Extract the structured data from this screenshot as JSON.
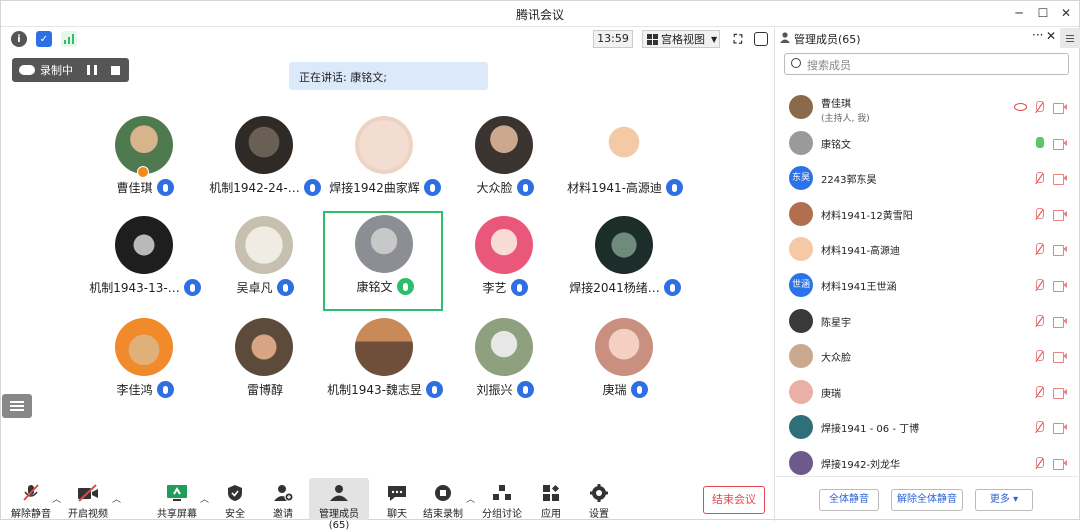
{
  "app": {
    "title": "腾讯会议"
  },
  "topbar": {
    "time": "13:59",
    "view_label": "宫格视图"
  },
  "recording": {
    "label": "录制中"
  },
  "speaking": {
    "text": "正在讲话: 康铭文;"
  },
  "participants": [
    {
      "name": "曹佳琪",
      "mic": "on",
      "host": true
    },
    {
      "name": "机制1942-24-…",
      "mic": "on"
    },
    {
      "name": "焊接1942曲家辉",
      "mic": "on"
    },
    {
      "name": "大众脸",
      "mic": "on"
    },
    {
      "name": "材料1941-高源迪",
      "mic": "on"
    },
    {
      "name": "机制1943-13-…",
      "mic": "on"
    },
    {
      "name": "吴卓凡",
      "mic": "on"
    },
    {
      "name": "康铭文",
      "mic": "speaking",
      "active": true
    },
    {
      "name": "李艺",
      "mic": "on"
    },
    {
      "name": "焊接2041杨绪…",
      "mic": "on"
    },
    {
      "name": "李佳鸿",
      "mic": "on"
    },
    {
      "name": "雷博醇",
      "mic": "none"
    },
    {
      "name": "机制1943-魏志昱",
      "mic": "on"
    },
    {
      "name": "刘振兴",
      "mic": "on"
    },
    {
      "name": "庚瑞",
      "mic": "on"
    }
  ],
  "toolbar": {
    "unmute": "解除静音",
    "start_video": "开启视频",
    "share_screen": "共享屏幕",
    "security": "安全",
    "invite": "邀请",
    "manage_members": "管理成员(65)",
    "chat": "聊天",
    "end_recording": "结束录制",
    "breakout": "分组讨论",
    "apps": "应用",
    "settings": "设置",
    "end_meeting": "结束会议"
  },
  "panel": {
    "title": "管理成员(65)",
    "more": "···",
    "close": "✕",
    "search_placeholder": "搜索成员",
    "members": [
      {
        "name": "曹佳琪",
        "sub": "(主持人, 我)",
        "mic": "muted",
        "recording": true
      },
      {
        "name": "康铭文",
        "mic": "on"
      },
      {
        "name": "2243郭东昊",
        "avatar_text": "东昊",
        "mic": "muted"
      },
      {
        "name": "材料1941-12黄雪阳",
        "mic": "muted"
      },
      {
        "name": "材料1941-高源迪",
        "mic": "muted"
      },
      {
        "name": "材料1941王世涵",
        "avatar_text": "世涵",
        "mic": "muted"
      },
      {
        "name": "陈星宇",
        "mic": "muted"
      },
      {
        "name": "大众脸",
        "mic": "muted"
      },
      {
        "name": "庚瑞",
        "mic": "muted"
      },
      {
        "name": "焊接1941 - 06 - 丁博",
        "mic": "muted"
      },
      {
        "name": "焊接1942-刘龙华",
        "mic": "muted"
      }
    ],
    "mute_all": "全体静音",
    "unmute_all": "解除全体静音",
    "more_btn": "更多 ▾"
  },
  "colors": {
    "accent": "#2f6fe4",
    "active_border": "#2fbd6b",
    "danger": "#e5484d"
  }
}
